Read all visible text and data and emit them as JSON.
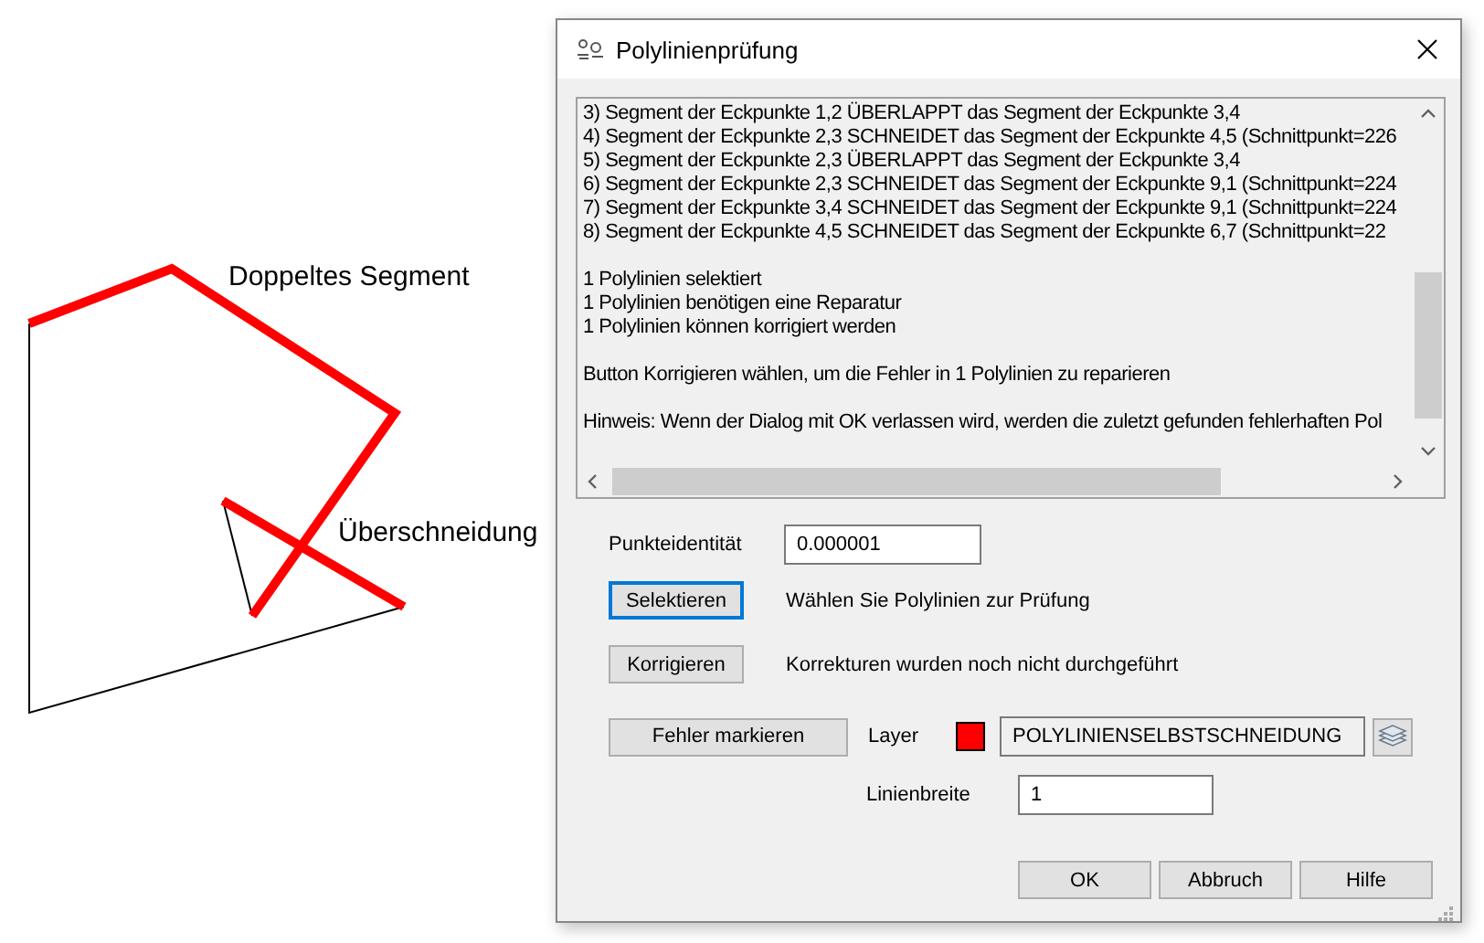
{
  "canvas": {
    "labels": [
      "Doppeltes Segment",
      "Überschneidung"
    ]
  },
  "dialog": {
    "title": "Polylinienprüfung",
    "report": {
      "segments": [
        "3) Segment der Eckpunkte 1,2 ÜBERLAPPT das Segment der Eckpunkte 3,4",
        "4) Segment der Eckpunkte 2,3 SCHNEIDET das Segment der Eckpunkte 4,5 (Schnittpunkt=226",
        "5) Segment der Eckpunkte 2,3 ÜBERLAPPT das Segment der Eckpunkte 3,4",
        "6) Segment der Eckpunkte 2,3 SCHNEIDET das Segment der Eckpunkte 9,1 (Schnittpunkt=224",
        "7) Segment der Eckpunkte 3,4 SCHNEIDET das Segment der Eckpunkte 9,1 (Schnittpunkt=224",
        "8) Segment der Eckpunkte 4,5 SCHNEIDET das Segment der Eckpunkte 6,7 (Schnittpunkt=22"
      ],
      "summary": [
        "1 Polylinien selektiert",
        "1 Polylinien benötigen eine Reparatur",
        "1 Polylinien können korrigiert werden"
      ],
      "instruction": "Button Korrigieren wählen, um die Fehler in 1 Polylinien zu reparieren",
      "note": "Hinweis: Wenn der Dialog mit OK verlassen wird, werden die zuletzt gefunden fehlerhaften Pol"
    },
    "tolerance": {
      "label": "Punkteidentität",
      "value": "0.000001"
    },
    "actions": [
      {
        "label": "Selektieren",
        "focused": true,
        "status": "Wählen Sie Polylinien zur Prüfung"
      },
      {
        "label": "Korrigieren",
        "focused": false,
        "status": "Korrekturen wurden noch nicht durchgeführt"
      }
    ],
    "mark_button": "Fehler markieren",
    "layer": {
      "label": "Layer",
      "color": "#ff0000",
      "value": "POLYLINIENSELBSTSCHNEIDUNG"
    },
    "line_width": {
      "label": "Linienbreite",
      "value": "1"
    },
    "buttons": [
      "OK",
      "Abbruch",
      "Hilfe"
    ]
  }
}
